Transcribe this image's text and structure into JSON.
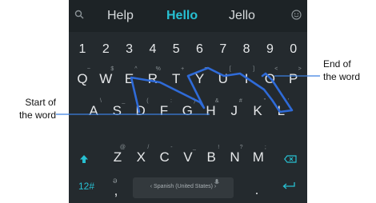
{
  "suggestions": {
    "left": "Help",
    "center": "Hello",
    "right": "Jello"
  },
  "icons": {
    "search": "search-icon",
    "emoji": "emoji-icon",
    "shift": "shift-icon",
    "backspace": "backspace-icon",
    "enter": "enter-icon",
    "mic": "mic-icon"
  },
  "rows": {
    "numbers": [
      "1",
      "2",
      "3",
      "4",
      "5",
      "6",
      "7",
      "8",
      "9",
      "0"
    ],
    "row1": [
      {
        "m": "Q",
        "s": "~"
      },
      {
        "m": "W",
        "s": "$"
      },
      {
        "m": "E",
        "s": "^"
      },
      {
        "m": "R",
        "s": "%"
      },
      {
        "m": "T",
        "s": "+"
      },
      {
        "m": "Y",
        "s": "="
      },
      {
        "m": "U",
        "s": "["
      },
      {
        "m": "I",
        "s": "]"
      },
      {
        "m": "O",
        "s": "<"
      },
      {
        "m": "P",
        "s": ">"
      }
    ],
    "row2": [
      {
        "m": "A",
        "s": "\\"
      },
      {
        "m": "S",
        "s": "_"
      },
      {
        "m": "D",
        "s": "("
      },
      {
        "m": "F",
        "s": ":"
      },
      {
        "m": "G",
        "s": ")"
      },
      {
        "m": "H",
        "s": "&"
      },
      {
        "m": "J",
        "s": "#"
      },
      {
        "m": "K",
        "s": "\""
      },
      {
        "m": "L",
        "s": "'"
      }
    ],
    "row3": [
      {
        "m": "Z",
        "s": "@"
      },
      {
        "m": "X",
        "s": "/"
      },
      {
        "m": "C",
        "s": "-"
      },
      {
        "m": "V",
        "s": "_"
      },
      {
        "m": "B",
        "s": "!"
      },
      {
        "m": "N",
        "s": "?"
      },
      {
        "m": "M",
        "s": ";"
      }
    ]
  },
  "bottom": {
    "symbols": "12#",
    "comma": ",",
    "period": ".",
    "language": "Spanish (United States)"
  },
  "annotations": {
    "start": "Start of\nthe word",
    "end": "End of\nthe word"
  },
  "colors": {
    "keyboard": "#242a2e",
    "accent": "#27c0d2",
    "trail": "#2f6bd8",
    "callout": "#3a7fe0"
  }
}
